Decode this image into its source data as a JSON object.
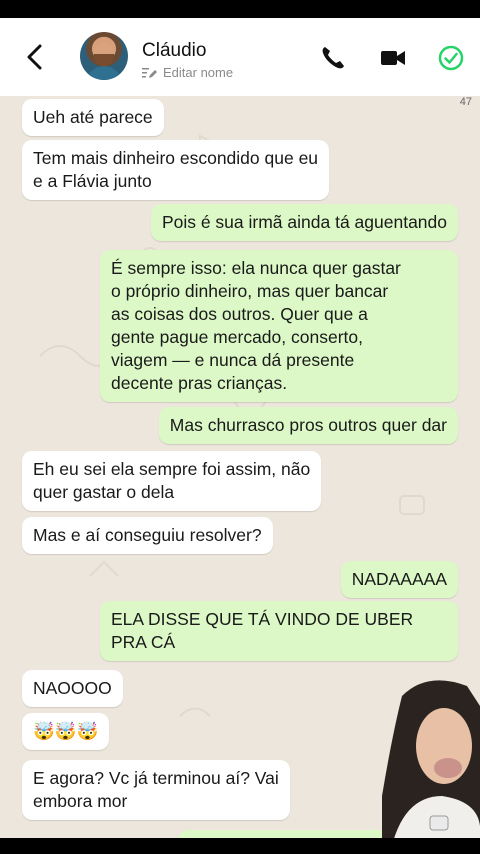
{
  "header": {
    "contact_name": "Cláudio",
    "edit_label": "Editar nome",
    "icons": [
      "back-chevron-icon",
      "phone-icon",
      "video-icon",
      "check-circle-icon",
      "pencil-lines-icon"
    ],
    "accent_color": "#25d366"
  },
  "chat": {
    "counter": "47",
    "messages": [
      {
        "side": "in",
        "text": "Ueh até parece"
      },
      {
        "side": "in",
        "text": "Tem mais dinheiro escondido que eu\ne a Flávia junto"
      },
      {
        "side": "out",
        "text": "Pois é sua irmã ainda tá aguentando"
      },
      {
        "side": "out",
        "text": "É sempre isso: ela nunca quer gastar\no próprio dinheiro, mas quer bancar\nas coisas dos outros. Quer que a\ngente pague mercado, conserto,\nviagem — e nunca dá presente\ndecente pras crianças."
      },
      {
        "side": "out",
        "text": "Mas churrasco pros outros quer dar"
      },
      {
        "side": "in",
        "text": "Eh eu sei ela sempre foi assim, não\nquer gastar o dela"
      },
      {
        "side": "in",
        "text": "Mas e aí conseguiu resolver?"
      },
      {
        "side": "out",
        "text": "NADAAAAA"
      },
      {
        "side": "out",
        "text": "ELA DISSE QUE TÁ VINDO DE UBER\nPRA CÁ"
      },
      {
        "side": "in",
        "text": "NAOOOO"
      },
      {
        "side": "in",
        "text": "🤯🤯🤯"
      },
      {
        "side": "in",
        "text": "E agora? Vc já terminou aí? Vai\nembora mor"
      }
    ]
  },
  "colors": {
    "incoming": "#ffffff",
    "outgoing": "#dbf8c6",
    "wallpaper": "#ece6dc"
  }
}
